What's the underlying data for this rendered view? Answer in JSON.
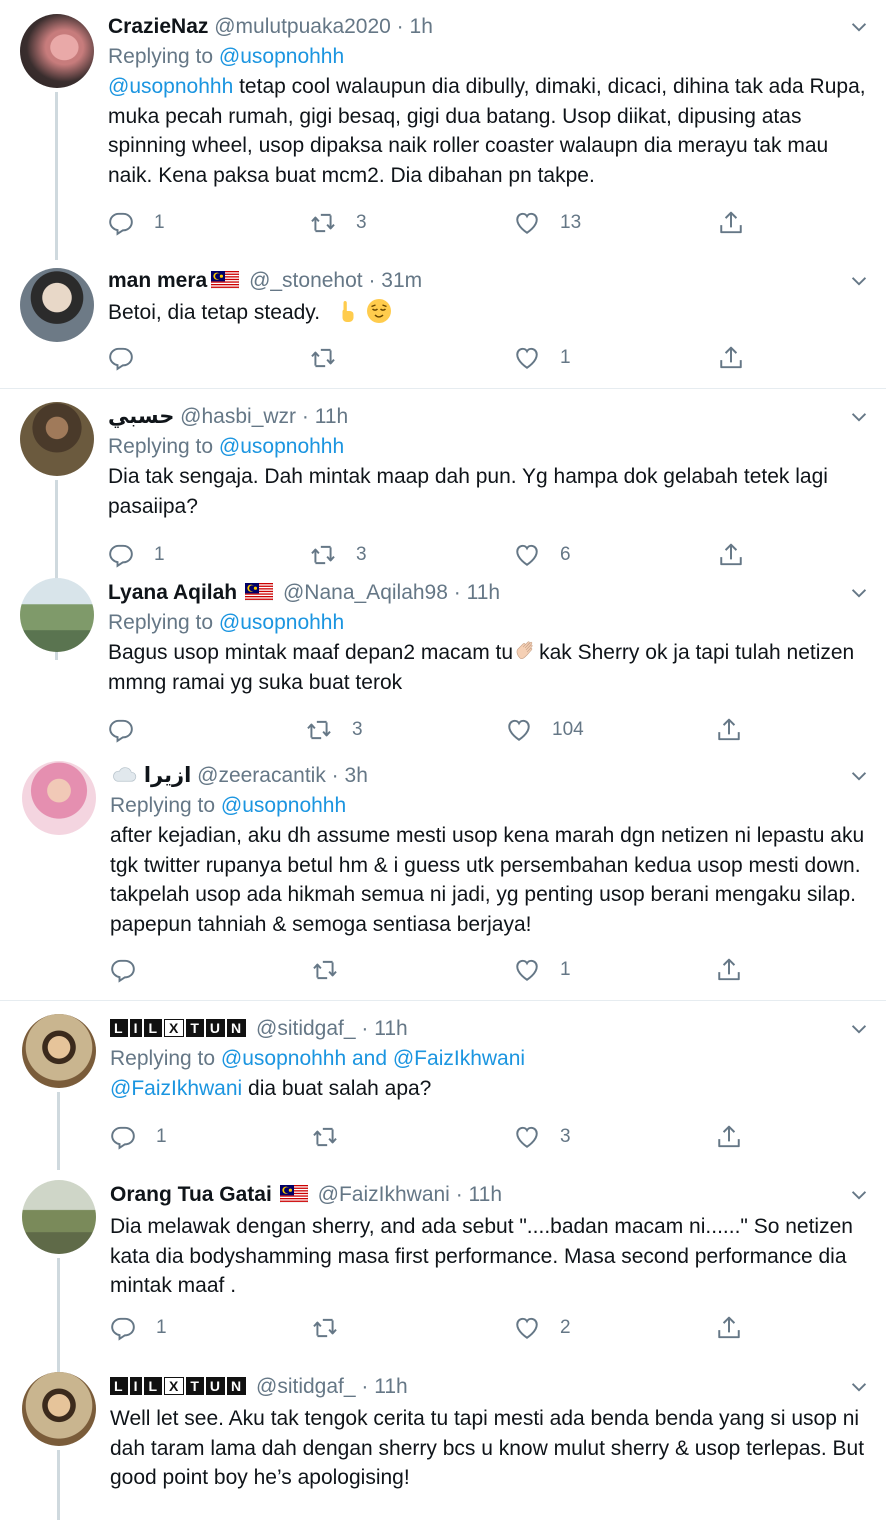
{
  "tweets": [
    {
      "name": "CrazieNaz",
      "handle": "@mulutpuaka2020",
      "time": "1h",
      "replying_prefix": "Replying to ",
      "replying_to": "@usopnohhh",
      "mention": "@usopnohhh",
      "text": " tetap cool walaupun dia dibully, dimaki, dicaci, dihina tak ada Rupa, muka pecah rumah, gigi besaq, gigi dua batang. Usop diikat, dipusing atas spinning wheel, usop dipaksa naik roller coaster walaupn dia merayu tak mau naik. Kena paksa buat mcm2. Dia dibahan pn takpe.",
      "replies": "1",
      "retweets": "3",
      "likes": "13"
    },
    {
      "name": "man mera",
      "handle": "@_stonehot",
      "time": "31m",
      "text": "Betoi, dia tetap steady.",
      "replies": "",
      "retweets": "",
      "likes": "1"
    },
    {
      "name": "حسبي",
      "handle": "@hasbi_wzr",
      "time": "11h",
      "replying_prefix": "Replying to ",
      "replying_to": "@usopnohhh",
      "text": "Dia tak sengaja. Dah mintak maap dah pun. Yg hampa dok gelabah tetek lagi pasaiipa?",
      "replies": "1",
      "retweets": "3",
      "likes": "6"
    },
    {
      "name": "Lyana Aqilah",
      "handle": "@Nana_Aqilah98",
      "time": "11h",
      "replying_prefix": "Replying to ",
      "replying_to": "@usopnohhh",
      "text_before": "Bagus usop mintak maaf depan2 macam tu",
      "text_after": "kak Sherry ok ja tapi tulah netizen mmng ramai yg suka buat terok",
      "replies": "",
      "retweets": "3",
      "likes": "104"
    },
    {
      "name": "ازيرا",
      "handle": "@zeeracantik",
      "time": "3h",
      "replying_prefix": "Replying to ",
      "replying_to": "@usopnohhh",
      "text": "after kejadian, aku dh assume mesti usop kena marah dgn netizen ni lepastu aku tgk twitter rupanya betul hm & i guess utk persembahan kedua usop mesti down. takpelah usop ada hikmah semua ni jadi, yg penting usop berani mengaku silap. papepun tahniah & semoga sentiasa berjaya!",
      "replies": "",
      "retweets": "",
      "likes": "1"
    },
    {
      "name_badge": [
        "L",
        "I",
        "L",
        "X",
        "T",
        "U",
        "N"
      ],
      "handle": "@sitidgaf_",
      "time": "11h",
      "replying_prefix": "Replying to ",
      "replying_to": "@usopnohhh and @FaizIkhwani",
      "mention": "@FaizIkhwani",
      "text": " dia buat salah apa?",
      "replies": "1",
      "retweets": "",
      "likes": "3"
    },
    {
      "name": "Orang Tua Gatai",
      "handle": "@FaizIkhwani",
      "time": "11h",
      "text": "Dia melawak dengan sherry, and ada sebut \"....badan macam ni......\" So netizen kata dia bodyshamming masa first performance. Masa second performance dia mintak maaf .",
      "replies": "1",
      "retweets": "",
      "likes": "2"
    },
    {
      "name_badge": [
        "L",
        "I",
        "L",
        "X",
        "T",
        "U",
        "N"
      ],
      "handle": "@sitidgaf_",
      "time": "11h",
      "text": "Well let see. Aku tak tengok cerita tu tapi mesti ada benda benda yang si usop ni dah taram lama dah dengan sherry bcs u know mulut sherry & usop terlepas. But good point boy he’s apologising!"
    }
  ],
  "sep": " · ",
  "colors": {
    "link": "#1b95e0",
    "muted": "#657786",
    "line": "#cfd9de"
  }
}
